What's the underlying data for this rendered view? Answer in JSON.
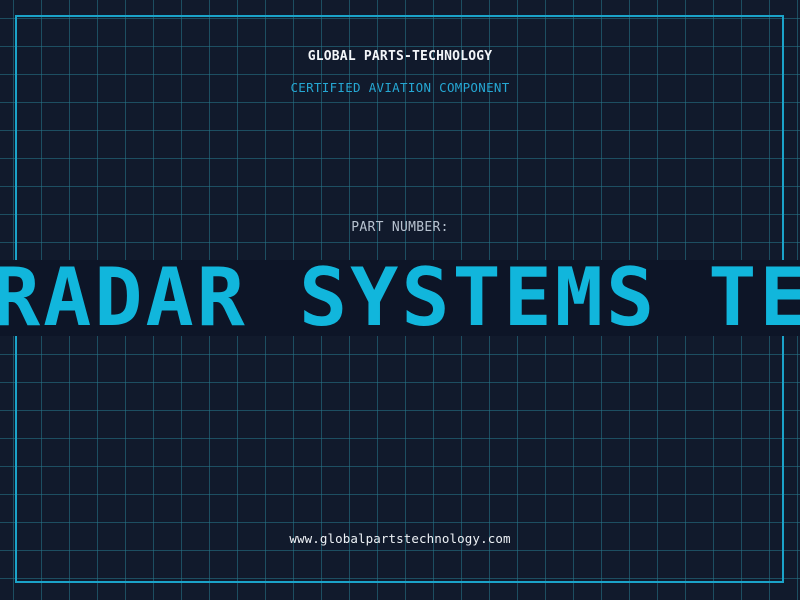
{
  "header": {
    "company": "GLOBAL PARTS-TECHNOLOGY",
    "subtitle": "CERTIFIED AVIATION COMPONENT"
  },
  "part": {
    "label": "PART NUMBER:",
    "value": "RADAR SYSTEMS TECH"
  },
  "footer": {
    "website": "www.globalpartstechnology.com"
  },
  "colors": {
    "background": "#111a2c",
    "grid": "#26788c",
    "frame": "#1ba3c9",
    "accent": "#11b6dc",
    "label": "#b7c2cf",
    "text": "#f2f5f8"
  }
}
